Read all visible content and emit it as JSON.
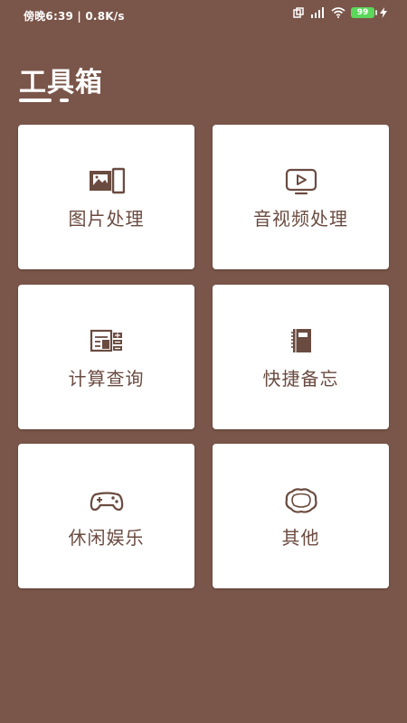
{
  "status_bar": {
    "left": "傍晚6:39 | 0.8K/s",
    "battery": "99"
  },
  "title": "工具箱",
  "tools": [
    {
      "label": "图片处理",
      "icon": "picture-icon"
    },
    {
      "label": "音视频处理",
      "icon": "play-video-icon"
    },
    {
      "label": "计算查询",
      "icon": "calculator-icon"
    },
    {
      "label": "快捷备忘",
      "icon": "notebook-icon"
    },
    {
      "label": "休闲娱乐",
      "icon": "gamepad-icon"
    },
    {
      "label": "其他",
      "icon": "other-blob-icon"
    }
  ],
  "colors": {
    "background": "#7a5549",
    "card": "#ffffff",
    "text": "#6a4b40"
  }
}
